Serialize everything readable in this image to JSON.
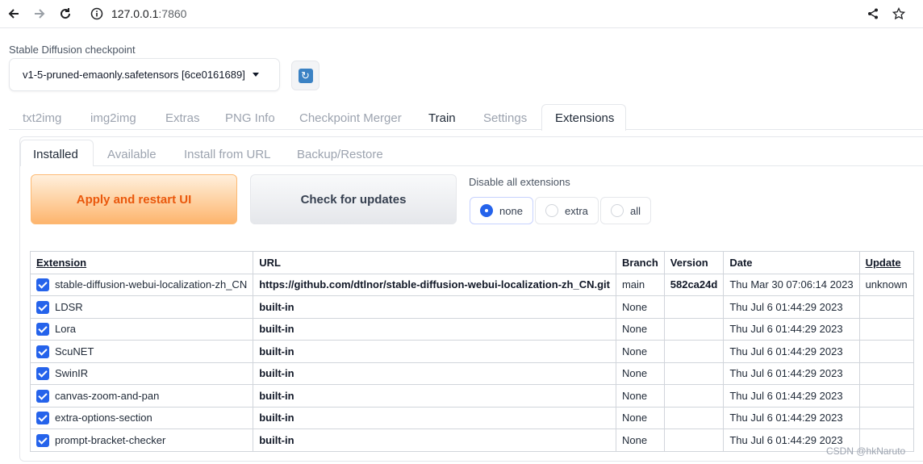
{
  "browser": {
    "url_host": "127.0.0.1",
    "url_port": ":7860",
    "back_icon": "arrow-left",
    "forward_icon": "arrow-right",
    "reload_icon": "reload",
    "info_icon": "info",
    "share_icon": "share",
    "bookmark_icon": "star"
  },
  "checkpoint": {
    "label": "Stable Diffusion checkpoint",
    "value": "v1-5-pruned-emaonly.safetensors [6ce0161689]",
    "refresh_icon": "🔄"
  },
  "tabs": [
    {
      "label": "txt2img"
    },
    {
      "label": "img2img"
    },
    {
      "label": "Extras"
    },
    {
      "label": "PNG Info"
    },
    {
      "label": "Checkpoint Merger"
    },
    {
      "label": "Train"
    },
    {
      "label": "Settings"
    },
    {
      "label": "Extensions"
    }
  ],
  "subtabs": [
    {
      "label": "Installed"
    },
    {
      "label": "Available"
    },
    {
      "label": "Install from URL"
    },
    {
      "label": "Backup/Restore"
    }
  ],
  "actions": {
    "apply_label": "Apply and restart UI",
    "check_label": "Check for updates"
  },
  "disable": {
    "label": "Disable all extensions",
    "options": [
      "none",
      "extra",
      "all"
    ],
    "selected": "none"
  },
  "table": {
    "headers": [
      "Extension",
      "URL",
      "Branch",
      "Version",
      "Date",
      "Update"
    ],
    "rows": [
      {
        "name": "stable-diffusion-webui-localization-zh_CN",
        "url": "https://github.com/dtlnor/stable-diffusion-webui-localization-zh_CN.git",
        "branch": "main",
        "version": "582ca24d",
        "date": "Thu Mar 30 07:06:14 2023",
        "update": "unknown"
      },
      {
        "name": "LDSR",
        "url": "built-in",
        "branch": "None",
        "version": "",
        "date": "Thu Jul 6 01:44:29 2023",
        "update": ""
      },
      {
        "name": "Lora",
        "url": "built-in",
        "branch": "None",
        "version": "",
        "date": "Thu Jul 6 01:44:29 2023",
        "update": ""
      },
      {
        "name": "ScuNET",
        "url": "built-in",
        "branch": "None",
        "version": "",
        "date": "Thu Jul 6 01:44:29 2023",
        "update": ""
      },
      {
        "name": "SwinIR",
        "url": "built-in",
        "branch": "None",
        "version": "",
        "date": "Thu Jul 6 01:44:29 2023",
        "update": ""
      },
      {
        "name": "canvas-zoom-and-pan",
        "url": "built-in",
        "branch": "None",
        "version": "",
        "date": "Thu Jul 6 01:44:29 2023",
        "update": ""
      },
      {
        "name": "extra-options-section",
        "url": "built-in",
        "branch": "None",
        "version": "",
        "date": "Thu Jul 6 01:44:29 2023",
        "update": ""
      },
      {
        "name": "prompt-bracket-checker",
        "url": "built-in",
        "branch": "None",
        "version": "",
        "date": "Thu Jul 6 01:44:29 2023",
        "update": ""
      }
    ]
  },
  "watermark": "CSDN @hkNaruto",
  "colors": {
    "accent": "#2563eb",
    "apply_text": "#ea580c"
  }
}
